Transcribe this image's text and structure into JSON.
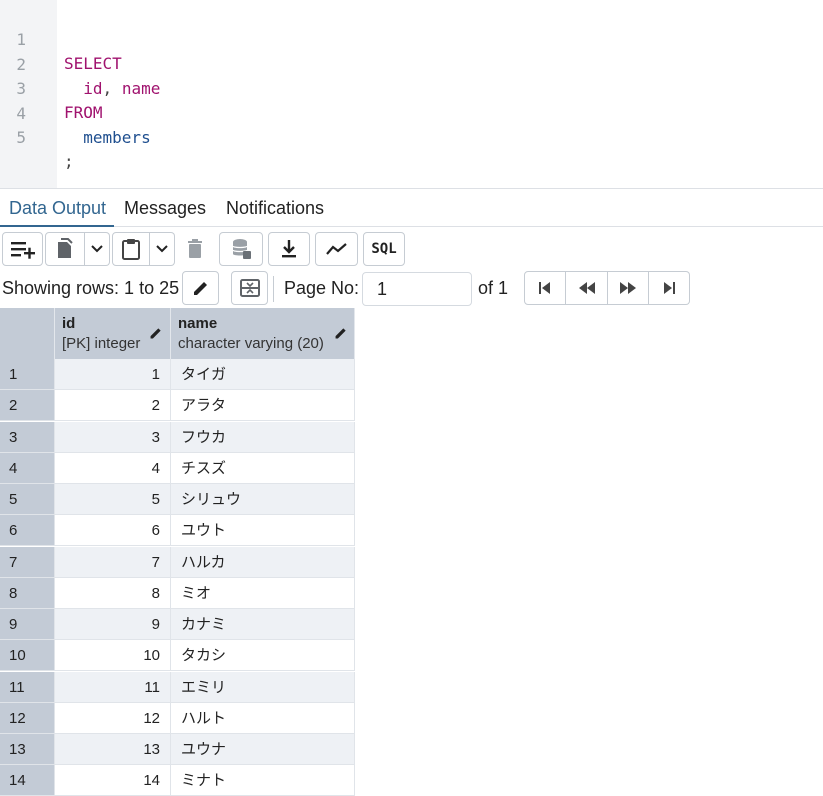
{
  "editor": {
    "lines": [
      {
        "num": "1",
        "kw": "SELECT"
      },
      {
        "num": "2",
        "col1": "id",
        "sep": ",",
        "col2": "name"
      },
      {
        "num": "3",
        "kw": "FROM"
      },
      {
        "num": "4",
        "table": "members"
      },
      {
        "num": "5",
        "end": ";"
      }
    ]
  },
  "tabs": [
    {
      "label": "Data Output",
      "active": true
    },
    {
      "label": "Messages",
      "active": false
    },
    {
      "label": "Notifications",
      "active": false
    }
  ],
  "toolbar": {
    "sql_label": "SQL",
    "icons": [
      "add-row-icon",
      "copy-icon",
      "chevron-down-icon",
      "paste-icon",
      "chevron-down-icon",
      "delete-icon",
      "save-data-icon",
      "download-icon",
      "graph-icon",
      "sql-icon"
    ]
  },
  "status": {
    "showing": "Showing rows: 1 to 25",
    "page_label": "Page No:",
    "page_value": "1",
    "of_label": "of 1"
  },
  "grid": {
    "columns": [
      {
        "name": "id",
        "type": "[PK] integer"
      },
      {
        "name": "name",
        "type": "character varying (20)"
      }
    ],
    "rows": [
      {
        "n": "1",
        "id": "1",
        "name": "タイガ"
      },
      {
        "n": "2",
        "id": "2",
        "name": "アラタ"
      },
      {
        "n": "3",
        "id": "3",
        "name": "フウカ"
      },
      {
        "n": "4",
        "id": "4",
        "name": "チスズ"
      },
      {
        "n": "5",
        "id": "5",
        "name": "シリュウ"
      },
      {
        "n": "6",
        "id": "6",
        "name": "ユウト"
      },
      {
        "n": "7",
        "id": "7",
        "name": "ハルカ"
      },
      {
        "n": "8",
        "id": "8",
        "name": "ミオ"
      },
      {
        "n": "9",
        "id": "9",
        "name": "カナミ"
      },
      {
        "n": "10",
        "id": "10",
        "name": "タカシ"
      },
      {
        "n": "11",
        "id": "11",
        "name": "エミリ"
      },
      {
        "n": "12",
        "id": "12",
        "name": "ハルト"
      },
      {
        "n": "13",
        "id": "13",
        "name": "ユウナ"
      },
      {
        "n": "14",
        "id": "14",
        "name": "ミナト"
      }
    ]
  }
}
